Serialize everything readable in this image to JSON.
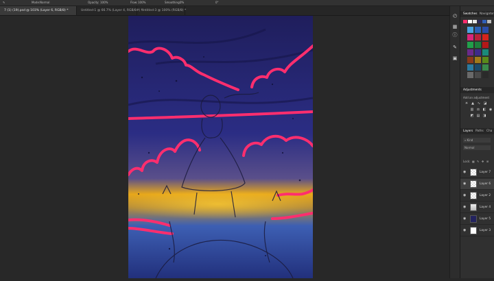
{
  "options_bar": {
    "mode_label": "Mode:",
    "mode_value": "Normal",
    "opacity_label": "Opacity:",
    "opacity_value": "100%",
    "flow_label": "Flow:",
    "flow_value": "100%",
    "smoothing_label": "Smoothing:",
    "smoothing_value": "0%",
    "angle_value": "0°"
  },
  "tabs": [
    {
      "label": "7 (1) (19).psd @ 103% (Layer 6, RGB/8) *"
    },
    {
      "label": "Untitled-1 @ 66.7% (Layer 4, RGB/8#) *"
    },
    {
      "label": "Untitled-3 @ 100% (RGB/8) *"
    }
  ],
  "panels": {
    "swatches_tab": "Swatches",
    "navigator_tab": "Navigator",
    "adjustments_tab": "Adjustments",
    "add_adjustment": "Add an adjustment",
    "layers_tab": "Layers",
    "paths_tab": "Paths",
    "channels_tab": "Cha",
    "filter_kind": "Kind",
    "blend_mode": "Normal",
    "lock_label": "Lock:"
  },
  "layers": [
    {
      "name": "Layer 7",
      "selected": false
    },
    {
      "name": "Layer 6",
      "selected": true
    },
    {
      "name": "Layer 2",
      "selected": false
    },
    {
      "name": "Layer 4",
      "selected": false
    },
    {
      "name": "Layer 5",
      "selected": false
    },
    {
      "name": "Layer 3",
      "selected": false
    }
  ],
  "colors": {
    "canvas_top": "#24246e",
    "canvas_mid": "#2a2f88",
    "glow_yellow": "#f0b21a",
    "neon_pink": "#ff2e6e",
    "canvas_bottom": "#2f5fb8"
  },
  "icons": {
    "eye": "eye-icon",
    "toolbar": [
      "history-icon",
      "info-icon",
      "brush-settings-icon",
      "adjust-icon"
    ]
  }
}
